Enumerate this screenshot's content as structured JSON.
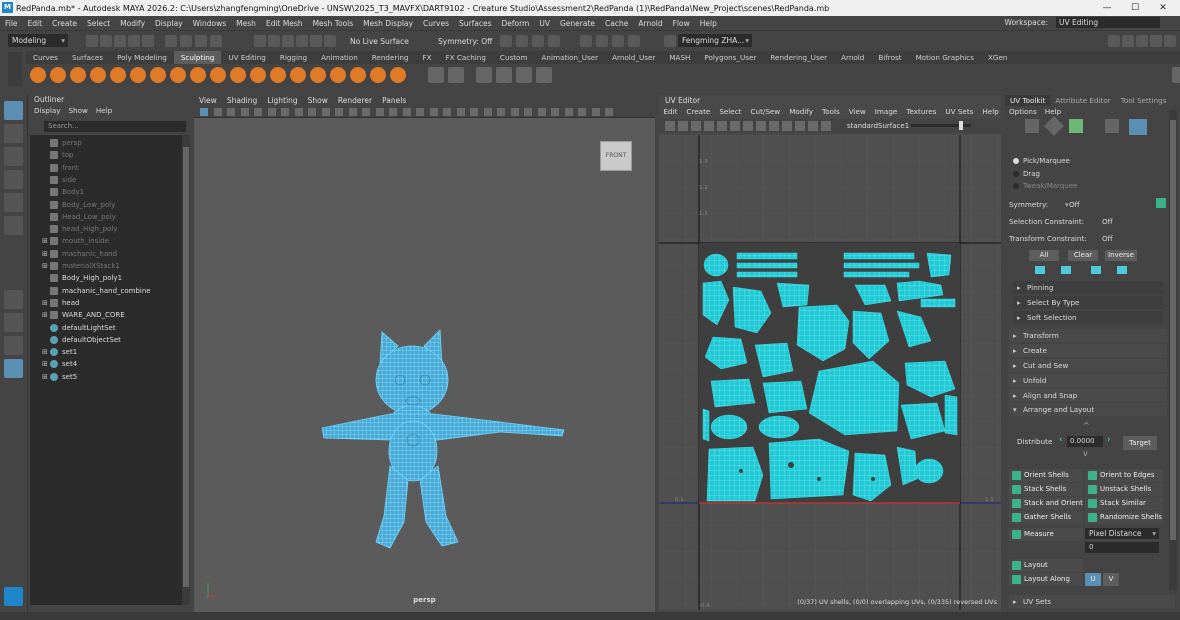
{
  "title": "RedPanda.mb* - Autodesk MAYA 2026.2: C:\\Users\\zhangfengming\\OneDrive - UNSW\\2025_T3_MAVFX\\DART9102 - Creature Studio\\Assessment2\\RedPanda (1)\\RedPanda\\New_Project\\scenes\\RedPanda.mb",
  "window_controls": {
    "minimize": "—",
    "maximize": "☐",
    "close": "✕"
  },
  "menu": [
    "File",
    "Edit",
    "Create",
    "Select",
    "Modify",
    "Display",
    "Windows",
    "Mesh",
    "Edit Mesh",
    "Mesh Tools",
    "Mesh Display",
    "Curves",
    "Surfaces",
    "Deform",
    "UV",
    "Generate",
    "Cache",
    "Arnold",
    "Flow",
    "Help"
  ],
  "workspace": {
    "label": "Workspace:",
    "value": "UV Editing"
  },
  "status": {
    "mode": "Modeling",
    "live_surface": "No Live Surface",
    "symmetry": "Symmetry: Off",
    "user": "Fengming ZHA..."
  },
  "shelf_tabs": [
    "Curves",
    "Surfaces",
    "Poly Modeling",
    "Sculpting",
    "UV Editing",
    "Rigging",
    "Animation",
    "Rendering",
    "FX",
    "FX Caching",
    "Custom",
    "Animation_User",
    "Arnold_User",
    "MASH",
    "Polygons_User",
    "Rendering_User",
    "Arnold",
    "Bifrost",
    "Motion Graphics",
    "XGen"
  ],
  "active_shelf_tab": "Sculpting",
  "outliner": {
    "title": "Outliner",
    "menu": [
      "Display",
      "Show",
      "Help"
    ],
    "search_placeholder": "Search...",
    "items": [
      {
        "label": "persp",
        "dim": true,
        "exp": ""
      },
      {
        "label": "top",
        "dim": true,
        "exp": ""
      },
      {
        "label": "front",
        "dim": true,
        "exp": ""
      },
      {
        "label": "side",
        "dim": true,
        "exp": ""
      },
      {
        "label": "Body1",
        "dim": true,
        "exp": ""
      },
      {
        "label": "Body_Low_poly",
        "dim": true,
        "exp": ""
      },
      {
        "label": "Head_Low_poly",
        "dim": true,
        "exp": ""
      },
      {
        "label": "head_High_poly",
        "dim": true,
        "exp": ""
      },
      {
        "label": "mouth_inside",
        "dim": true,
        "exp": "⊞"
      },
      {
        "label": "machanic_hand",
        "dim": true,
        "exp": "⊞"
      },
      {
        "label": "materialXStack1",
        "dim": true,
        "exp": "⊞"
      },
      {
        "label": "Body_High_poly1",
        "dim": false,
        "exp": ""
      },
      {
        "label": "machanic_hand_combine",
        "dim": false,
        "exp": ""
      },
      {
        "label": "head",
        "dim": false,
        "exp": "⊞"
      },
      {
        "label": "WARE_AND_CORE",
        "dim": false,
        "exp": "⊞"
      },
      {
        "label": "defaultLightSet",
        "dim": false,
        "exp": ""
      },
      {
        "label": "defaultObjectSet",
        "dim": false,
        "exp": ""
      },
      {
        "label": "set1",
        "dim": false,
        "exp": "⊞"
      },
      {
        "label": "set4",
        "dim": false,
        "exp": "⊞"
      },
      {
        "label": "set5",
        "dim": false,
        "exp": "⊞"
      }
    ]
  },
  "viewport": {
    "menu": [
      "View",
      "Shading",
      "Lighting",
      "Show",
      "Renderer",
      "Panels"
    ],
    "camera": "persp",
    "viewcube": "FRONT"
  },
  "uv_editor": {
    "title": "UV Editor",
    "menu": [
      "Edit",
      "Create",
      "Select",
      "Cut/Sew",
      "Modify",
      "Tools",
      "View",
      "Image",
      "Textures",
      "UV Sets",
      "Help"
    ],
    "texture": "standardSurface1",
    "grid_labels_v": [
      "1.3",
      "1.2",
      "1.1"
    ],
    "tick_labels": {
      "left_zero": "0.1",
      "right_one": "1.1",
      "bottom": "-0.4"
    },
    "status": "(0/37) UV shells, (0/0) overlapping UVs, (0/335) reversed UVs"
  },
  "toolkit": {
    "tabs": [
      "UV Toolkit",
      "Attribute Editor",
      "Tool Settings"
    ],
    "menu": [
      "Options",
      "Help"
    ],
    "pick_modes": [
      {
        "label": "Pick/Marquee",
        "on": true
      },
      {
        "label": "Drag",
        "on": false
      },
      {
        "label": "Tweak/Marquee",
        "on": false
      }
    ],
    "symmetry": {
      "label": "Symmetry:",
      "value": "Off"
    },
    "selection_constraint": {
      "label": "Selection Constraint:",
      "value": "Off"
    },
    "transform_constraint": {
      "label": "Transform Constraint:",
      "value": "Off"
    },
    "sel_buttons": [
      "All",
      "Clear",
      "Inverse"
    ],
    "inner_sections": [
      "Pinning",
      "Select By Type",
      "Soft Selection"
    ],
    "sections": [
      "Transform",
      "Create",
      "Cut and Sew",
      "Unfold",
      "Align and Snap"
    ],
    "arrange": "Arrange and Layout",
    "distribute": {
      "label": "Distribute",
      "value": "0.0000",
      "target": "Target"
    },
    "layout_buttons": [
      [
        "Orient Shells",
        "Orient to Edges"
      ],
      [
        "Stack Shells",
        "Unstack Shells"
      ],
      [
        "Stack and Orient",
        "Stack Similar"
      ],
      [
        "Gather Shells",
        "Randomize Shells"
      ]
    ],
    "measure": {
      "label": "Measure",
      "value": "Pixel Distance",
      "amount": "0"
    },
    "layout": "Layout",
    "layout_along": {
      "label": "Layout Along",
      "u": "U",
      "v": "V"
    },
    "uv_sets": "UV Sets"
  },
  "colors": {
    "accent": "#4ec9d9",
    "wire": "#6fd8ff",
    "selected_uv": "#2fd3de"
  }
}
